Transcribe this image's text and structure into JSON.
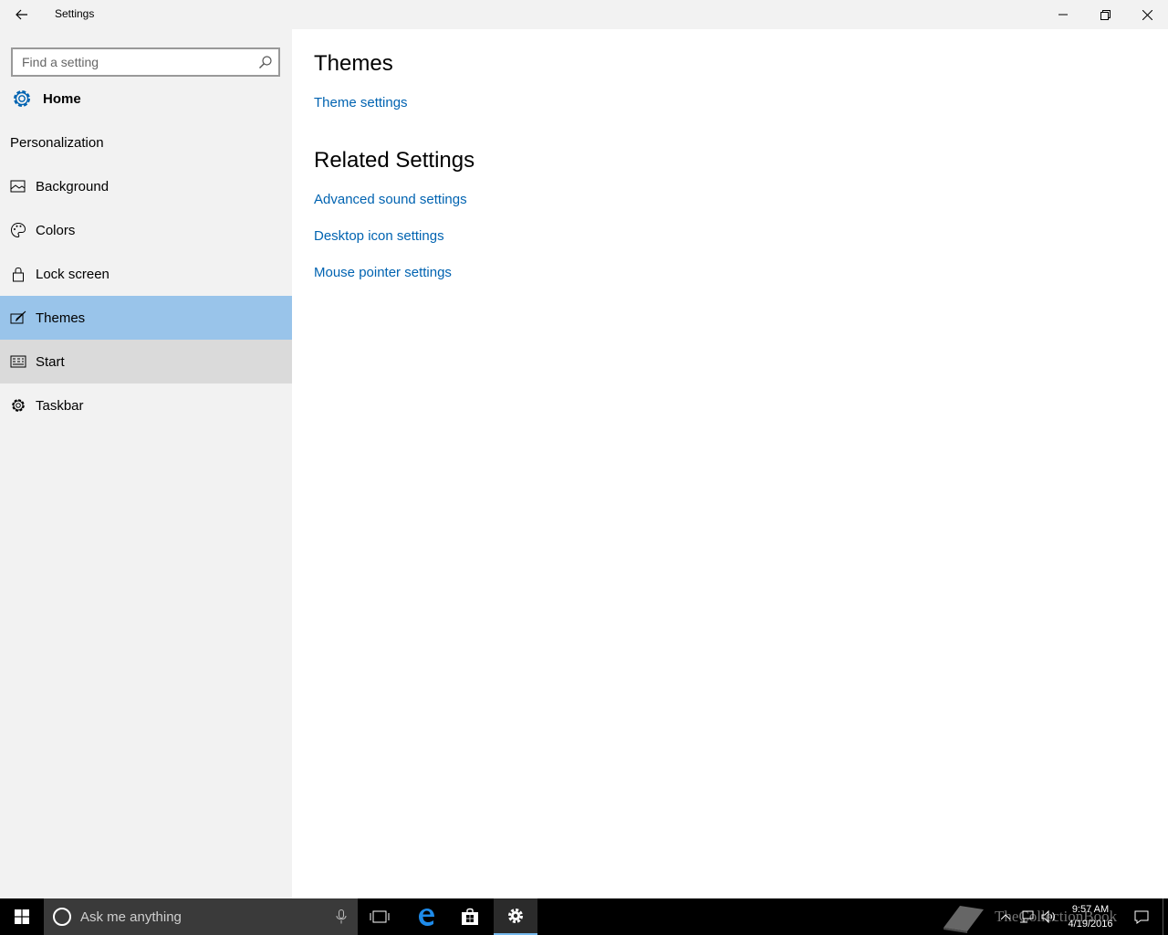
{
  "window": {
    "title": "Settings",
    "controls": {
      "minimize": "minimize-icon",
      "maximize": "restore-icon",
      "close": "close-icon"
    }
  },
  "sidebar": {
    "search_placeholder": "Find a setting",
    "home_label": "Home",
    "section": "Personalization",
    "items": [
      {
        "label": "Background",
        "icon": "picture-icon",
        "state": "normal"
      },
      {
        "label": "Colors",
        "icon": "palette-icon",
        "state": "normal"
      },
      {
        "label": "Lock screen",
        "icon": "lock-icon",
        "state": "normal"
      },
      {
        "label": "Themes",
        "icon": "brush-icon",
        "state": "selected"
      },
      {
        "label": "Start",
        "icon": "start-icon",
        "state": "hover"
      },
      {
        "label": "Taskbar",
        "icon": "gear-icon",
        "state": "normal"
      }
    ]
  },
  "main": {
    "themes_heading": "Themes",
    "theme_settings_link": "Theme settings",
    "related_heading": "Related Settings",
    "related_links": [
      "Advanced sound settings",
      "Desktop icon settings",
      "Mouse pointer settings"
    ]
  },
  "taskbar": {
    "cortana_placeholder": "Ask me anything",
    "clock_time": "9:57 AM",
    "clock_date": "4/19/2016",
    "watermark": "TheCollectionBook",
    "accent": "#76b9ed"
  },
  "colors": {
    "link": "#0063b1",
    "selected": "#99c4ea",
    "hover": "#dadada",
    "sidebar_bg": "#f2f2f2"
  }
}
